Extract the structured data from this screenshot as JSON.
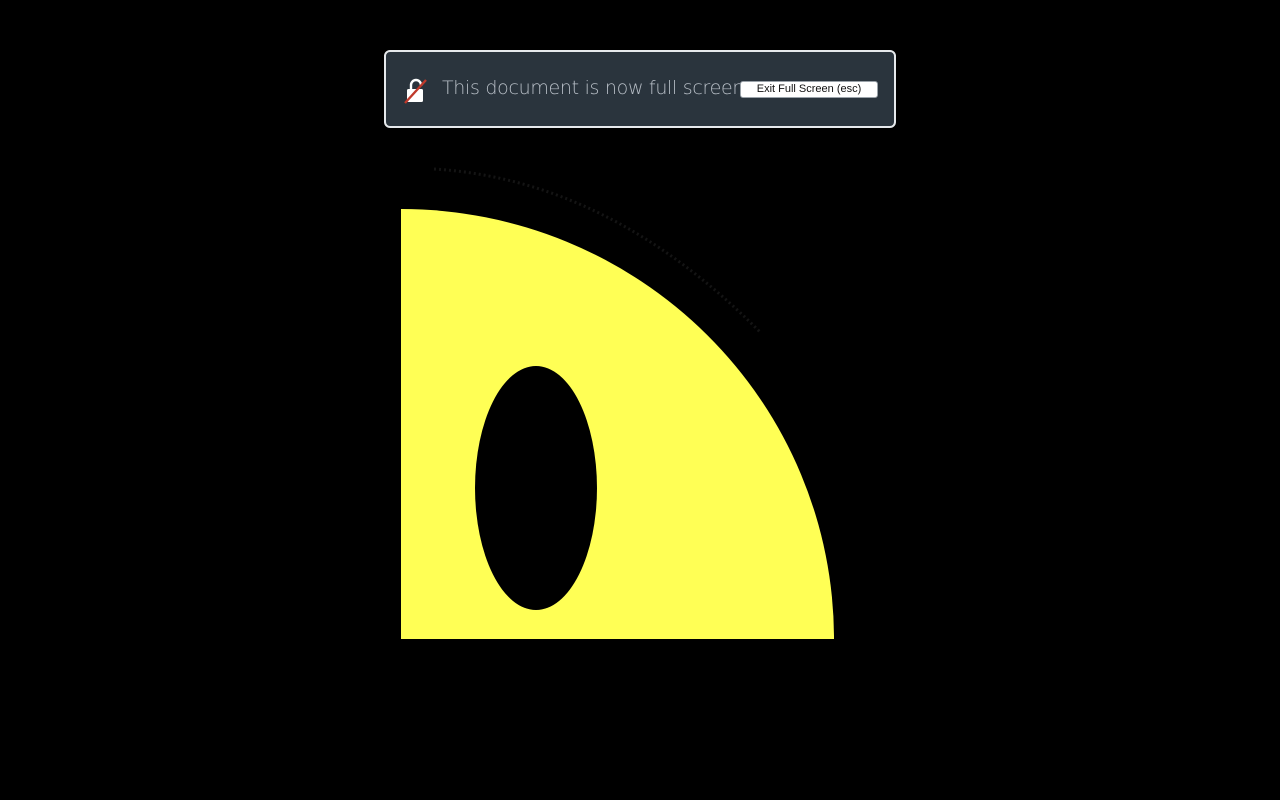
{
  "fullscreen_notice": {
    "message": "This document is now full screen",
    "exit_button_label": "Exit Full Screen (esc)",
    "icon": "unlocked-lock-icon"
  },
  "content": {
    "shape": "smiley-face-quarter",
    "face_color": "#FFFF55",
    "eye_color": "#000000",
    "background_color": "#000000"
  }
}
